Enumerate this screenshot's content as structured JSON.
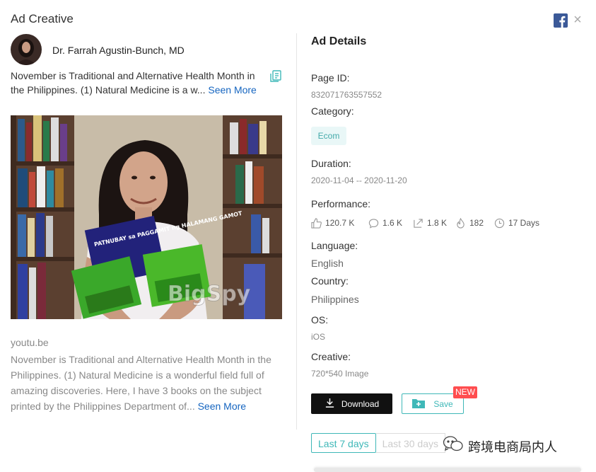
{
  "header": {
    "title": "Ad Creative",
    "close_icon": "×"
  },
  "ad": {
    "author": "Dr. Farrah Agustin-Bunch, MD",
    "description_short": "November is Traditional and Alternative Health Month in the Philippines. (1) Natural Medicine is a w...",
    "see_more_label": "Seen More",
    "image_watermark": "BigSpy",
    "book1_title": "PATNUBAY sa PAGGAMIT ng HALAMANG GAMOT",
    "link_domain": "youtu.be",
    "description_long": "November is Traditional and Alternative Health Month in the Philippines. (1) Natural Medicine is a wonderful field full of amazing discoveries. Here, I have 3 books on the subject printed by the Philippines Department of...",
    "see_more_long_label": "Seen More"
  },
  "details": {
    "title": "Ad Details",
    "page_id_label": "Page ID:",
    "page_id": "832071763557552",
    "category_label": "Category:",
    "category": "Ecom",
    "duration_label": "Duration:",
    "duration": "2020-11-04 -- 2020-11-20",
    "performance_label": "Performance:",
    "performance": {
      "likes": "120.7 K",
      "comments": "1.6 K",
      "shares": "1.8 K",
      "heat": "182",
      "days": "17 Days"
    },
    "language_label": "Language:",
    "language": "English",
    "country_label": "Country:",
    "country": "Philippines",
    "os_label": "OS:",
    "os": "iOS",
    "creative_label": "Creative:",
    "creative": "720*540 Image"
  },
  "actions": {
    "download": "Download",
    "save": "Save",
    "new_badge": "NEW"
  },
  "range": {
    "tabs": [
      "Last 7 days",
      "Last 30 days"
    ],
    "selected": "Last 7 days"
  },
  "watermark": {
    "text": "跨境电商局内人"
  },
  "colors": {
    "accent": "#3fb8b8",
    "link": "#1565c0",
    "facebook": "#3b5998",
    "new_badge": "#ff4d4f"
  }
}
